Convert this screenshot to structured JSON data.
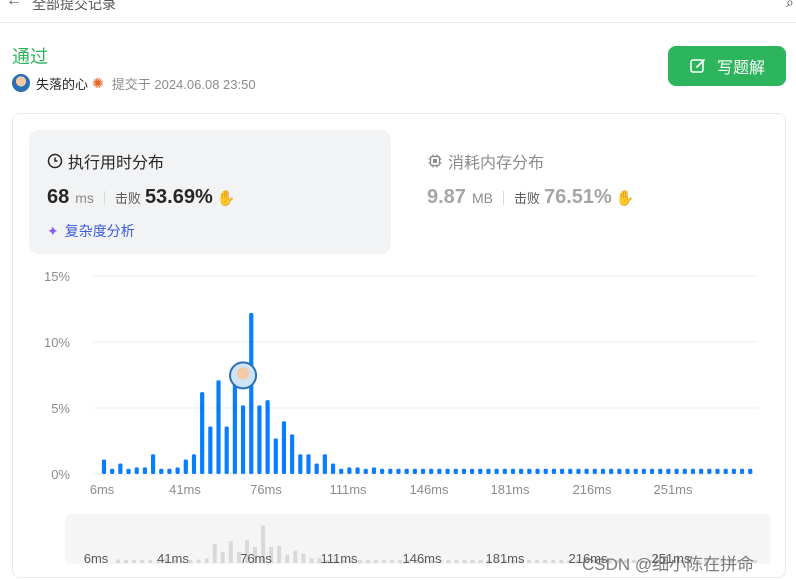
{
  "topbar": {
    "title": "全部提交记录"
  },
  "submission": {
    "status": "通过",
    "username": "失落的心",
    "submitted_at": "提交于 2024.06.08 23:50",
    "write_solution_label": "写题解"
  },
  "runtime": {
    "title": "执行用时分布",
    "value": "68",
    "unit": "ms",
    "beat_label": "击败",
    "beat_value": "53.69%",
    "complexity_label": "复杂度分析"
  },
  "memory": {
    "title": "消耗内存分布",
    "value": "9.87",
    "unit": "MB",
    "beat_label": "击败",
    "beat_value": "76.51%"
  },
  "chart_data": {
    "type": "bar",
    "title": "",
    "xlabel": "",
    "ylabel": "",
    "yticks": [
      "15%",
      "10%",
      "5%",
      "0%"
    ],
    "ylim": [
      0,
      15
    ],
    "xticks": [
      "6ms",
      "41ms",
      "76ms",
      "111ms",
      "146ms",
      "181ms",
      "216ms",
      "251ms"
    ],
    "values": [
      1.1,
      0.4,
      0.8,
      0.4,
      0.5,
      0.5,
      1.5,
      0.4,
      0.4,
      0.5,
      1.1,
      1.5,
      6.2,
      3.6,
      7.1,
      3.6,
      7.4,
      5.2,
      12.2,
      5.2,
      5.6,
      2.7,
      4.0,
      3.0,
      1.5,
      1.5,
      0.8,
      1.5,
      0.8,
      0.4,
      0.5,
      0.5,
      0.4,
      0.5,
      0.4,
      0.4,
      0.4,
      0.4,
      0.4,
      0.4,
      0.4,
      0.4,
      0.4,
      0.4,
      0.4,
      0.4,
      0.4,
      0.4,
      0.4,
      0.4,
      0.4,
      0.4,
      0.4,
      0.4,
      0.4,
      0.4,
      0.4,
      0.4,
      0.4,
      0.4,
      0.4,
      0.4,
      0.4,
      0.4,
      0.4,
      0.4,
      0.4,
      0.4,
      0.4,
      0.4,
      0.4,
      0.4,
      0.4,
      0.4,
      0.4,
      0.4,
      0.4,
      0.4,
      0.4,
      0.4
    ],
    "highlight_index": 17,
    "bar_color": "#0a7cff",
    "grid": true
  },
  "minimap": {
    "xticks": [
      "6ms",
      "41ms",
      "76ms",
      "111ms",
      "146ms",
      "181ms",
      "216ms",
      "251ms"
    ]
  },
  "watermark": "CSDN @细小陈在拼命"
}
